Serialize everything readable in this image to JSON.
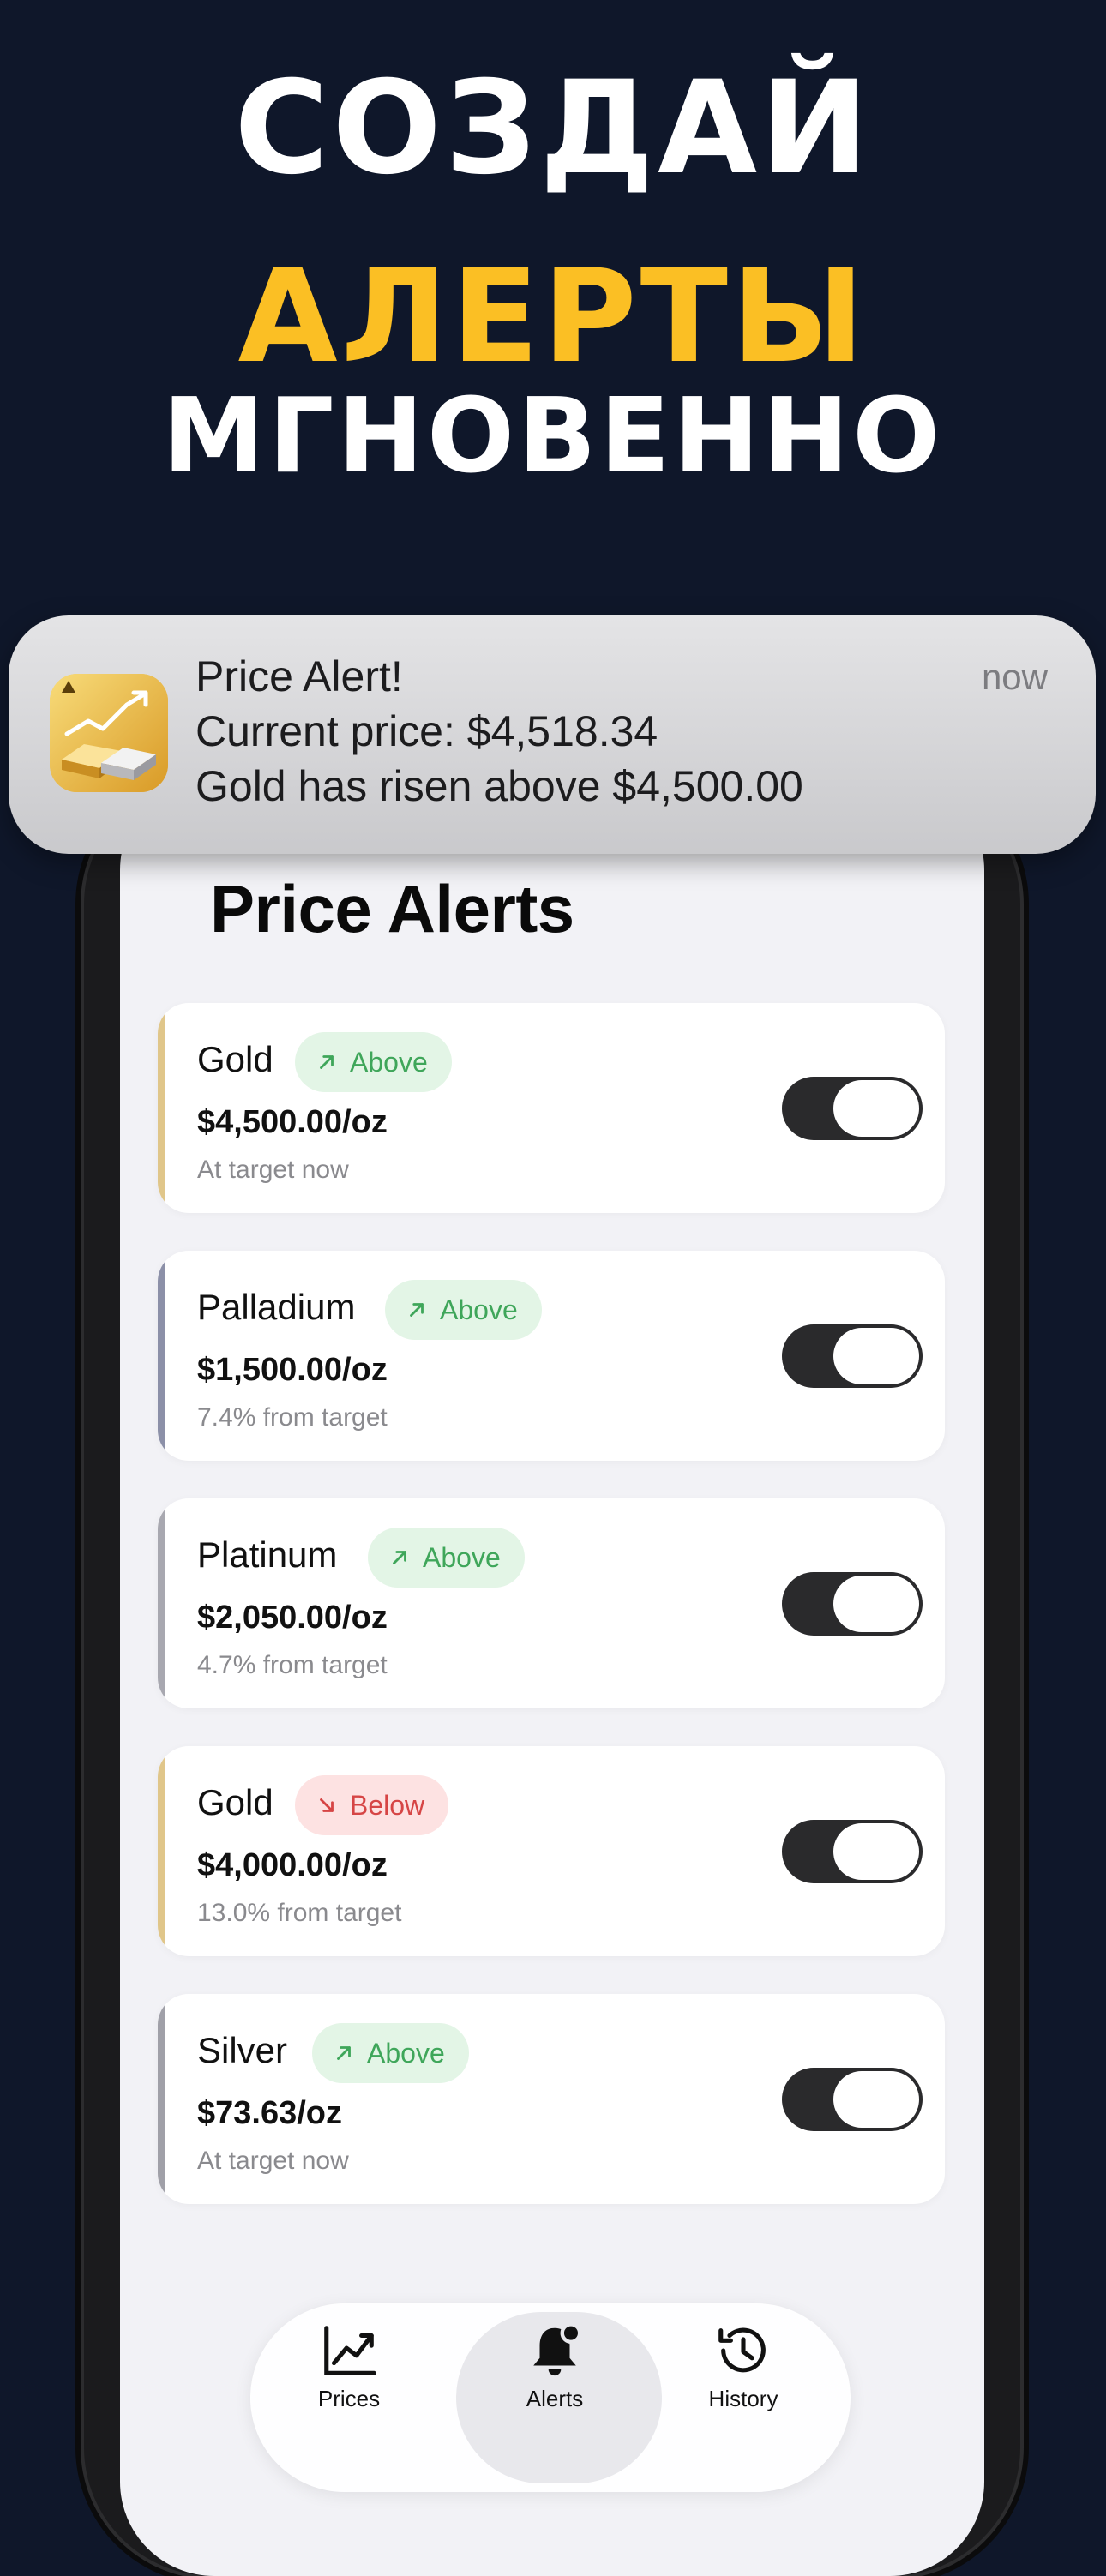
{
  "hero": {
    "line1": "СОЗДАЙ",
    "line2": "АЛЕРТЫ",
    "line3": "МГНОВЕННО"
  },
  "notification": {
    "title": "Price Alert!",
    "line1": "Current price: $4,518.34",
    "line2": "Gold has risen above $4,500.00",
    "time": "now",
    "app_icon": "gold-bars-chart-icon"
  },
  "screen": {
    "title": "Price Alerts"
  },
  "alerts": [
    {
      "metal": "Gold",
      "direction": "Above",
      "direction_icon": "arrow-up-right-icon",
      "price": "$4,500.00/oz",
      "status": "At target now",
      "accent": "#e0c68a",
      "enabled": true
    },
    {
      "metal": "Palladium",
      "direction": "Above",
      "direction_icon": "arrow-up-right-icon",
      "price": "$1,500.00/oz",
      "status": "7.4% from target",
      "accent": "#8c90a8",
      "enabled": true
    },
    {
      "metal": "Platinum",
      "direction": "Above",
      "direction_icon": "arrow-up-right-icon",
      "price": "$2,050.00/oz",
      "status": "4.7% from target",
      "accent": "#a8a8b0",
      "enabled": true
    },
    {
      "metal": "Gold",
      "direction": "Below",
      "direction_icon": "arrow-down-right-icon",
      "price": "$4,000.00/oz",
      "status": "13.0% from target",
      "accent": "#e0c68a",
      "enabled": true
    },
    {
      "metal": "Silver",
      "direction": "Above",
      "direction_icon": "arrow-up-right-icon",
      "price": "$73.63/oz",
      "status": "At target now",
      "accent": "#a0a0a8",
      "enabled": true
    }
  ],
  "tabs": [
    {
      "label": "Prices",
      "icon": "chart-line-icon"
    },
    {
      "label": "Alerts",
      "icon": "bell-badge-icon"
    },
    {
      "label": "History",
      "icon": "clock-history-icon"
    }
  ],
  "colors": {
    "background": "#0f172a",
    "accent_yellow": "#fbbf24",
    "above_green": "#3fa65a",
    "below_red": "#d64545"
  }
}
